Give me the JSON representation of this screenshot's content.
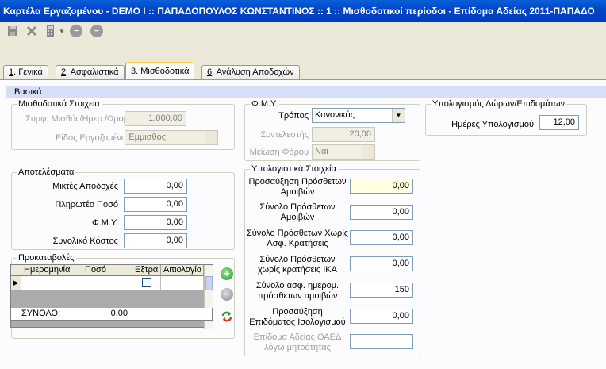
{
  "window": {
    "title": "Καρτέλα Εργαζομένου - DEMO I :: ΠΑΠΑΔΟΠΟΥΛΟΣ ΚΩΝΣΤΑΝΤΙΝΟΣ  :: 1  :: Μισθοδοτικοί περίοδοι  - Επίδομα Αδείας 2011-ΠΑΠΑΔΟ"
  },
  "toolbar": {
    "icons": [
      "save-icon",
      "delete-icon",
      "calculator-icon",
      "back-icon",
      "forward-icon"
    ]
  },
  "tabs": [
    {
      "key": "1",
      "label": ". Γενικά"
    },
    {
      "key": "2",
      "label": ". Ασφαλιστικά"
    },
    {
      "key": "3",
      "label": ". Μισθοδοτικά"
    },
    {
      "key": "6",
      "label": ". Ανάλυση Αποδοχών"
    }
  ],
  "section": {
    "label": "Βασικά"
  },
  "payroll": {
    "title": "Μισθοδοτικά Στοιχεία",
    "rate_label": "Συμφ. Μισθός/Ημερ./Ωρομ.",
    "rate_value": "1.000,00",
    "type_label": "Είδος Εργαζομένου",
    "type_value": "Έμμισθος"
  },
  "results": {
    "title": "Αποτελέσματα",
    "gross_label": "Μικτές Αποδοχές",
    "gross_value": "0,00",
    "payable_label": "Πληρωτέο Ποσό",
    "payable_value": "0,00",
    "tax_label": "Φ.Μ.Υ.",
    "tax_value": "0,00",
    "total_cost_label": "Συνολικό Κόστος",
    "total_cost_value": "0,00"
  },
  "advances": {
    "title": "Προκαταβολές",
    "columns": [
      "Ημερομηνία",
      "Ποσό",
      "Εξτρα",
      "Αιτιολογία"
    ],
    "row_marker": "▶",
    "total_label": "ΣΥΝΟΛΟ:",
    "total_value": "0,00"
  },
  "fmy": {
    "title": "Φ.Μ.Υ.",
    "method_label": "Τρόπος",
    "method_value": "Κανονικός",
    "coef_label": "Συντελεστής",
    "coef_value": "20,00",
    "reduction_label": "Μείωση Φόρου",
    "reduction_value": "Ναι"
  },
  "calc": {
    "title": "Υπολογιστικά Στοιχεία",
    "f1_label": "Προσαύξηση Πρόσθετων Αμοιβών",
    "f1_value": "0,00",
    "f2_label": "Σύνολο Πρόσθετων Αμοιβών",
    "f2_value": "0,00",
    "f3_label": "Σύνολο Πρόσθετων Χωρίς Ασφ. Κρατήσεις",
    "f3_value": "0,00",
    "f4_label": "Σύνολο Πρόσθετων χωρίς κρατήσεις ΙΚΑ",
    "f4_value": "0,00",
    "f5_label": "Σύνολο ασφ. ημερομ. πρόσθετων αμοιβών",
    "f5_value": "150",
    "f6_label": "Προσαύξηση Επιδόματος Ισολογισμού",
    "f6_value": "0,00",
    "f7_label": "Επίδομα Αδείας ΟΑΕΔ λόγω μητρότητας",
    "f7_value": ""
  },
  "gifts": {
    "title": "Υπολογισμός Δώρων/Επιδομάτων",
    "days_label": "Ημέρες Υπολογισμού",
    "days_value": "12,00"
  },
  "colors": {
    "title_bar": "#0047C8",
    "tab_highlight": "#FFC83C",
    "add_button": "#3CA03C",
    "remove_button": "#A0A0A0"
  }
}
